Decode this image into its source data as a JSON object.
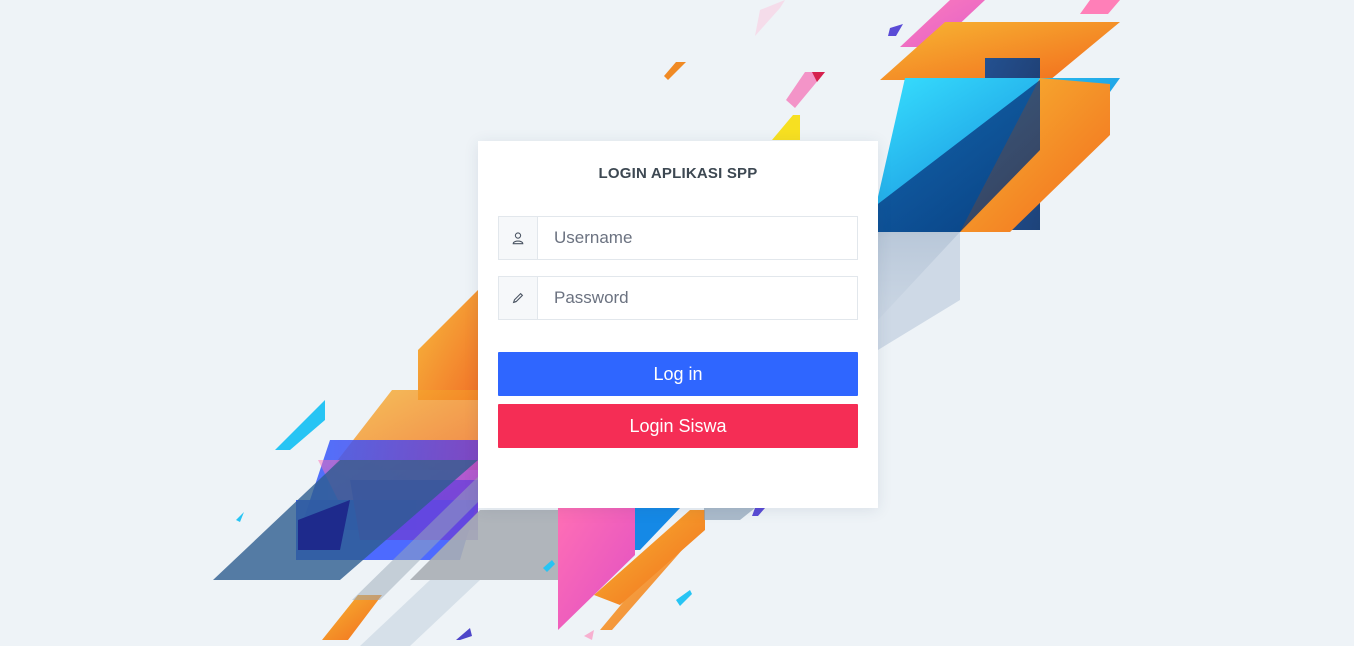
{
  "app": {
    "title": "LOGIN APLIKASI SPP"
  },
  "form": {
    "username_placeholder": "Username",
    "username_value": "",
    "username_icon": "user-icon",
    "password_placeholder": "Password",
    "password_value": "",
    "password_icon": "pencil-icon",
    "login_label": "Log in",
    "student_login_label": "Login Siswa"
  },
  "colors": {
    "background": "#eef3f7",
    "primary": "#2f66ff",
    "danger": "#f52d55",
    "card": "#ffffff"
  }
}
